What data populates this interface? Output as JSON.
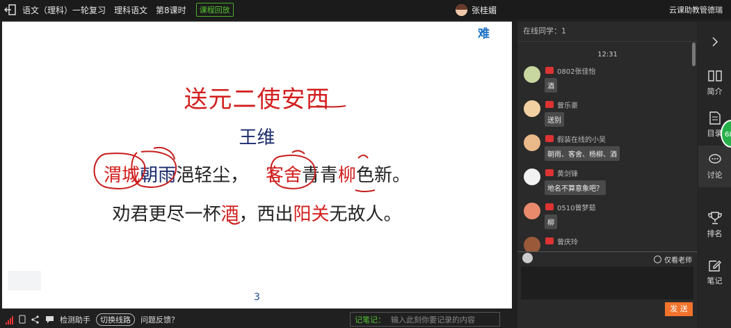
{
  "topbar": {
    "course": "语文（理科）一轮复习",
    "subject": "理科语文",
    "lesson": "第8课时",
    "replay": "课程回放",
    "teacher": "张桂媚",
    "assistant": "云课助教管德瑞"
  },
  "slide": {
    "watermark": "难",
    "title": "送元二使安西",
    "author": "王维",
    "line1": {
      "a": "渭城",
      "b": "朝雨",
      "c": "浥轻尘，",
      "d": "客舍",
      "e": "青青",
      "f": "柳",
      "g": "色新。"
    },
    "line2": {
      "a": "劝君更尽一杯",
      "b": "酒",
      "c": "，西出",
      "d": "阳关",
      "e": "无故人。"
    },
    "page": "3"
  },
  "bottombar": {
    "detect": "检测助手",
    "switch": "切换线路",
    "feedback": "问题反馈？",
    "note_label": "记笔记：",
    "note_placeholder": "输入此刻你要记录的内容"
  },
  "chat": {
    "online": "在线同学：1",
    "time": "12:31",
    "messages": [
      {
        "name": "0802张佳怡",
        "text": "酒"
      },
      {
        "name": "曾乐豪",
        "text": "送别"
      },
      {
        "name": "假装在线的小吴",
        "text": "朝雨、客舍、杨柳、酒"
      },
      {
        "name": "黄剑锋",
        "text": "地名不算意象吧？"
      },
      {
        "name": "0510曾梦茹",
        "text": "柳"
      },
      {
        "name": "曾庆玲",
        "text": ""
      }
    ],
    "only_teacher": "仅看老师",
    "send": "发 送"
  },
  "nav": {
    "intro": "简介",
    "catalog": "目录",
    "discuss": "讨论",
    "rank": "排名",
    "notes": "笔记"
  },
  "float_badge": "68",
  "colors": {
    "accent": "#f2732c",
    "green": "#56c332",
    "red_ink": "#d31e1e"
  }
}
